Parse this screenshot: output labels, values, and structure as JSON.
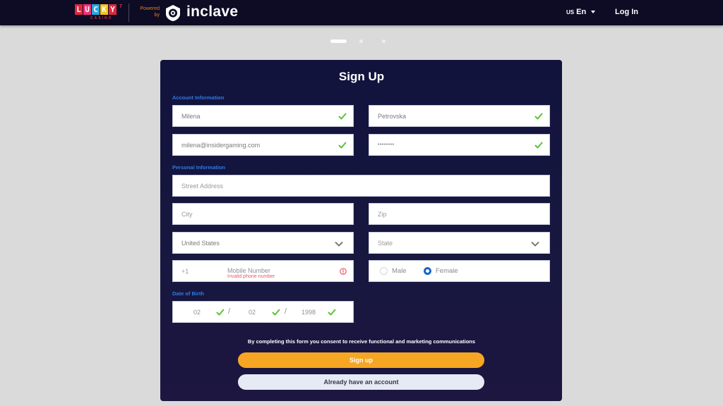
{
  "header": {
    "brand_letters": [
      "L",
      "U",
      "C",
      "K",
      "Y"
    ],
    "brand_letter_colors": [
      "#e0263e",
      "#f2317a",
      "#2aa7e0",
      "#f4c41b",
      "#e0263e"
    ],
    "brand_superscript": "7",
    "brand_sub": "CASINO",
    "powered_by_line1": "Powered",
    "powered_by_line2": "by",
    "partner_name": "inclave",
    "language_flag": "US",
    "language_label": "En",
    "login_label": "Log In"
  },
  "carousel": {
    "pages": 3,
    "active_index": 0
  },
  "form": {
    "title": "Sign Up",
    "account_section_label": "Account Information",
    "first_name": {
      "value": "Milena",
      "valid": true
    },
    "last_name": {
      "value": "Petrovska",
      "valid": true
    },
    "email": {
      "value": "milena@insidergaming.com",
      "valid": true
    },
    "password": {
      "value": "••••••••",
      "valid": true
    },
    "personal_section_label": "Personal Information",
    "street_address": {
      "placeholder": "Street Address"
    },
    "city": {
      "placeholder": "City"
    },
    "zip": {
      "placeholder": "Zip"
    },
    "country": {
      "value": "United States"
    },
    "state": {
      "placeholder": "State"
    },
    "phone": {
      "prefix": "+1",
      "placeholder": "Mobile Number",
      "error": "Invalid phone number"
    },
    "gender": {
      "options": [
        "Male",
        "Female"
      ],
      "selected": "Female"
    },
    "dob_section_label": "Date of Birth",
    "dob": {
      "month": "02",
      "day": "02",
      "year": "1998",
      "separator": "/"
    },
    "consent_text": "By completing this form you consent to receive functional and marketing communications",
    "signup_button": "Sign up",
    "account_button": "Already have an account"
  },
  "colors": {
    "accent_orange": "#f6a623",
    "section_blue": "#2f7ae5",
    "valid_green": "#5cc234",
    "error_red": "#e75a6a",
    "card_bg": "#12133d"
  }
}
